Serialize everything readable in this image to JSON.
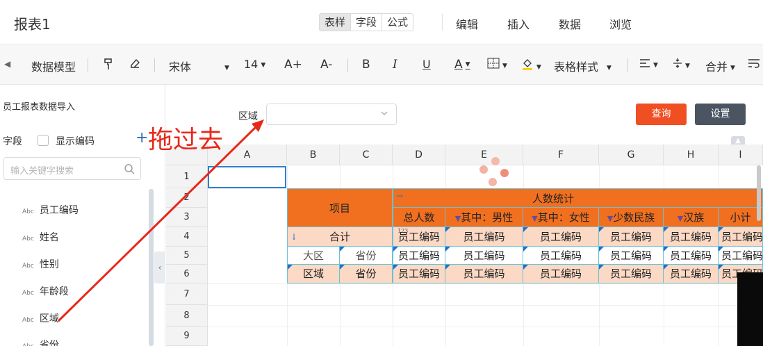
{
  "topbar": {
    "title": "报表1",
    "tabs": [
      "表样",
      "字段",
      "公式"
    ],
    "active_tab": "表样",
    "menus": [
      "编辑",
      "插入",
      "数据",
      "浏览"
    ]
  },
  "toolbar": {
    "data_model": "数据模型",
    "font": "宋体",
    "size": "14",
    "inc_font": "A+",
    "dec_font": "A-",
    "bold": "B",
    "italic": "I",
    "underline": "U",
    "font_color": "A",
    "table_style": "表格样式",
    "merge": "合并"
  },
  "sidebar": {
    "title": "员工报表数据导入",
    "field_label": "字段",
    "show_code": "显示编码",
    "search_placeholder": "输入关键字搜索",
    "type_tag": "Abc",
    "fields": [
      "员工编码",
      "姓名",
      "性别",
      "年龄段",
      "区域",
      "省份"
    ]
  },
  "main": {
    "region_label": "区域",
    "query_button": "查询",
    "settings_button": "设置"
  },
  "sheet": {
    "columns": [
      "A",
      "B",
      "C",
      "D",
      "E",
      "F",
      "G",
      "H",
      "I"
    ],
    "rows": [
      "1",
      "2",
      "3",
      "4",
      "5",
      "6",
      "7",
      "8",
      "9"
    ],
    "header_item": "项目",
    "header_count": "人数统计",
    "sub_headers": [
      "总人数",
      "其中：男性",
      "其中：女性",
      "少数民族",
      "汉族",
      "小计"
    ],
    "total": "合计",
    "big_region": "大区",
    "province": "省份",
    "region": "区域",
    "code": "员工编码",
    "tag_123": "123"
  },
  "annotation": {
    "text": "拖过去"
  },
  "colors": {
    "orange": "#f07020",
    "peach": "#fcd9c4",
    "accent_red": "#f04e23",
    "dark_button": "#4a5561"
  }
}
